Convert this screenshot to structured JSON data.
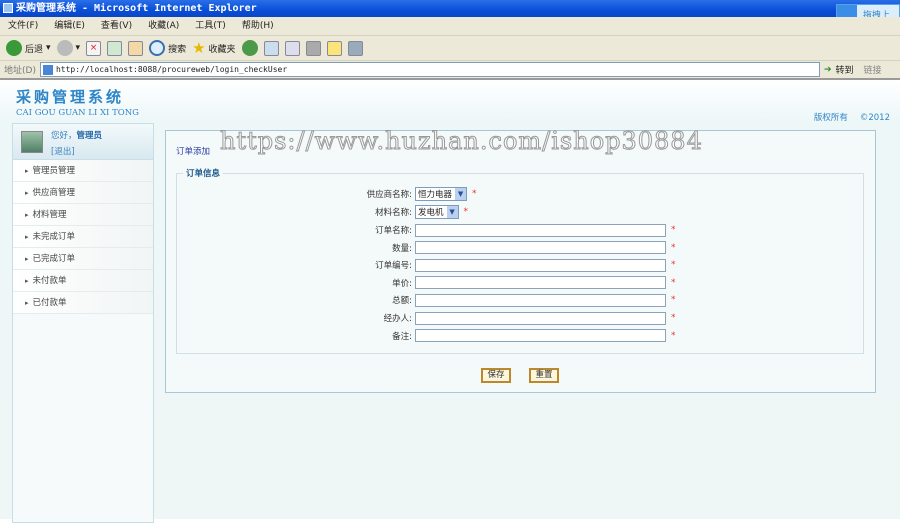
{
  "window": {
    "title": "采购管理系统 - Microsoft Internet Explorer"
  },
  "menu": [
    "文件(F)",
    "编辑(E)",
    "查看(V)",
    "收藏(A)",
    "工具(T)",
    "帮助(H)"
  ],
  "toolbar": {
    "back": "后退",
    "search": "搜索",
    "favorites": "收藏夹"
  },
  "address": {
    "label": "地址(D)",
    "url": "http://localhost:8088/procureweb/login_checkUser",
    "go": "转到",
    "links": "链接"
  },
  "cloud": {
    "label": "拖拽上"
  },
  "header": {
    "logo": "采购管理系统",
    "logo_sub": "CAI GOU GUAN LI XI TONG",
    "copyright": "版权所有",
    "year": "©2012"
  },
  "user": {
    "greeting": "您好，",
    "name": "管理员",
    "logout": "[退出]"
  },
  "sidebar": {
    "items": [
      "管理员管理",
      "供应商管理",
      "材料管理",
      "未完成订单",
      "已完成订单",
      "未付款单",
      "已付款单"
    ]
  },
  "main": {
    "breadcrumb": "订单添加",
    "legend": "订单信息",
    "supplier": {
      "label": "供应商名称:",
      "value": "恒力电器"
    },
    "material": {
      "label": "材料名称:",
      "value": "发电机"
    },
    "fields": [
      {
        "label": "订单名称:",
        "value": ""
      },
      {
        "label": "数量:",
        "value": ""
      },
      {
        "label": "订单编号:",
        "value": ""
      },
      {
        "label": "单价:",
        "value": ""
      },
      {
        "label": "总额:",
        "value": ""
      },
      {
        "label": "经办人:",
        "value": ""
      },
      {
        "label": "备注:",
        "value": ""
      }
    ],
    "required": "*",
    "save": "保存",
    "reset": "重置"
  },
  "watermark": "https://www.huzhan.com/ishop30884"
}
